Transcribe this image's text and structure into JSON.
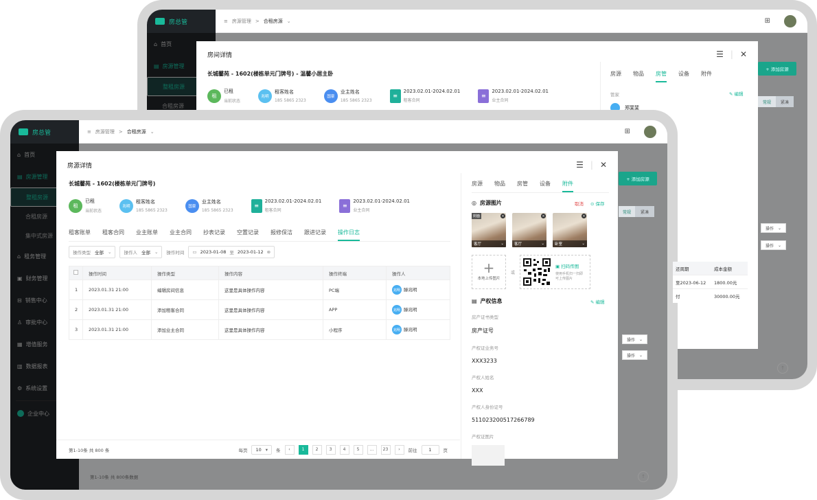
{
  "app": {
    "name": "房总管",
    "breadcrumb_root": "房源管理",
    "breadcrumb_current": "合租房源"
  },
  "sidebar_back": {
    "items": [
      "首页",
      "房源管理"
    ],
    "subs": [
      "整租房源",
      "合租房源"
    ]
  },
  "sidebar_front": {
    "items": [
      "首页",
      "房源管理"
    ],
    "subs": [
      "整租房源",
      "合租房源",
      "集中式房源"
    ],
    "groups": [
      "租务管理",
      "财务管理",
      "销售中心",
      "审批中心",
      "增值服务",
      "数据报表",
      "系统设置",
      "企业中心"
    ]
  },
  "back_modal": {
    "title": "房间详情",
    "subtitle": "长城馨苑 - 1602(楼栋单元门牌号) - 温馨小居主卧",
    "status": {
      "icon": "租",
      "value": "已租",
      "label": "当前状态"
    },
    "tenant": {
      "avatar": "兆明",
      "title": "租客姓名",
      "phone": "185 5865 2323"
    },
    "owner": {
      "avatar": "国豪",
      "title": "业主姓名",
      "phone": "185 5865 2323"
    },
    "contract1": {
      "date": "2023.02.01-2024.02.01",
      "label": "租客合同"
    },
    "contract2": {
      "date": "2023.02.01-2024.02.01",
      "label": "业主合同"
    },
    "tabs": [
      "房源",
      "物品",
      "房管",
      "设备",
      "附件"
    ],
    "manager_label": "管家",
    "edit": "编辑",
    "manager_name": "郑斐斐"
  },
  "back_right": {
    "add_button": "+ 添加房源",
    "chips": [
      "常规",
      "紧凑"
    ],
    "op": "操作",
    "col_period": "还周期",
    "col_cost": "成本金额",
    "row1_period": "至2023-06-12",
    "row1_cost": "1800.00元",
    "row2_period": "付",
    "row2_cost": "30000.00元"
  },
  "front_modal": {
    "title": "房源详情",
    "subtitle": "长城馨苑 - 1602(楼栋单元门牌号)",
    "status": {
      "icon": "租",
      "value": "已租",
      "label": "当前状态"
    },
    "tenant": {
      "avatar": "兆明",
      "title": "租客姓名",
      "phone": "185 5865 2323"
    },
    "owner": {
      "avatar": "国豪",
      "title": "业主姓名",
      "phone": "185 5865 2323"
    },
    "contract1": {
      "date": "2023.02.01-2024.02.01",
      "label": "租客合同"
    },
    "contract2": {
      "date": "2023.02.01-2024.02.01",
      "label": "业主合同"
    },
    "tabs": [
      "租客账单",
      "租客合同",
      "业主账单",
      "业主合同",
      "抄表记录",
      "空置记录",
      "报修保洁",
      "跟进记录",
      "操作日志"
    ],
    "filters": {
      "op_type_label": "操作类型",
      "op_type_value": "全部",
      "operator_label": "操作人",
      "operator_value": "全部",
      "time_label": "操作时间",
      "date_from": "2023-01-08",
      "date_sep": "至",
      "date_to": "2023-01-12"
    },
    "table": {
      "headers": [
        "操作时间",
        "操作类型",
        "操作内容",
        "操作终端",
        "操作人"
      ],
      "rows": [
        {
          "no": "1",
          "time": "2023.01.31 21:00",
          "type": "编辑房间信息",
          "content": "这里是具体操作内容",
          "terminal": "PC端",
          "avatar": "兆明",
          "user": "滕兆明"
        },
        {
          "no": "2",
          "time": "2023.01.31 21:00",
          "type": "添加租客合同",
          "content": "这里是具体操作内容",
          "terminal": "APP",
          "avatar": "兆明",
          "user": "滕兆明"
        },
        {
          "no": "3",
          "time": "2023.01.31 21:00",
          "type": "添加业主合同",
          "content": "这里是具体操作内容",
          "terminal": "小程序",
          "avatar": "兆明",
          "user": "滕兆明"
        }
      ]
    },
    "footer": {
      "summary": "第1-10条  共 800 条",
      "per_page": "每页",
      "per_value": "10",
      "unit": "条",
      "pages": [
        "1",
        "2",
        "3",
        "4",
        "5",
        "...",
        "23"
      ],
      "goto": "前往",
      "goto_value": "1",
      "page_unit": "页"
    }
  },
  "front_right": {
    "tabs": [
      "房源",
      "物品",
      "房管",
      "设备",
      "附件"
    ],
    "photos_title": "房源图片",
    "cancel": "取消",
    "save": "保存",
    "cover": "封面",
    "photos": [
      "客厅",
      "客厅",
      "卧室"
    ],
    "upload_label": "本地上传图片",
    "or": "或",
    "scan_title": "扫码传图",
    "scan_desc": "使用手机扫一扫即可上传图片",
    "rights_title": "产权信息",
    "edit": "编辑",
    "fields": [
      {
        "label": "房产证书类型",
        "value": "房产证号"
      },
      {
        "label": "产权证业务号",
        "value": "XXX3233"
      },
      {
        "label": "产权人姓名",
        "value": "XXX"
      },
      {
        "label": "产权人身份证号",
        "value": "511023200517266789"
      }
    ],
    "image_label": "产权证图片"
  },
  "front_right_bg": {
    "add_button": "+ 添加房源",
    "chips": [
      "常规",
      "紧凑"
    ],
    "op": "操作",
    "footer_summary": "第1-10条  共 800条数据"
  }
}
